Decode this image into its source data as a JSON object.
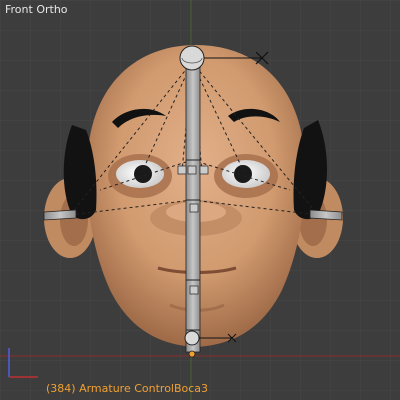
{
  "viewport": {
    "view_label": "Front Ortho",
    "frame_number": "(384)",
    "object_info": "Armature ControlBoca3",
    "status_text": "(384) Armature ControlBoca3"
  },
  "colors": {
    "background": "#3d3d3d",
    "grid": "#464646",
    "axis_red": "#9a2b2b",
    "axis_green": "#4a8a2a",
    "axis_x_gizmo": "#c03030",
    "axis_y_gizmo": "#5060e0",
    "skin": "#d7a277",
    "skin_shadow": "#9c6a48",
    "hair": "#141414",
    "bone": "#a8a8a8",
    "status_text": "#f0a030"
  },
  "icons": {
    "axis_gizmo": "axis-gizmo-icon",
    "cross_marker": "cross-marker-icon"
  }
}
